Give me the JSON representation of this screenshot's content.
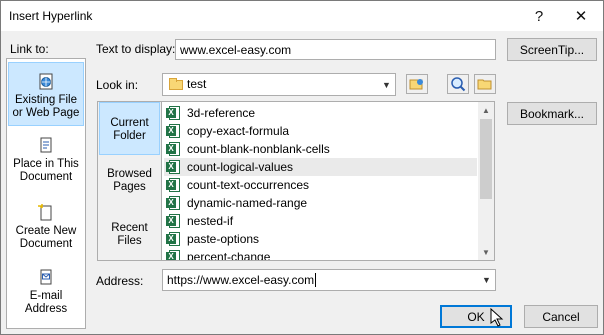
{
  "window": {
    "title": "Insert Hyperlink",
    "help_glyph": "?",
    "close_glyph": "✕"
  },
  "link_to": {
    "heading": "Link to:",
    "items": [
      {
        "label": "Existing File or Web Page",
        "icon": "globe-page-icon",
        "active": true
      },
      {
        "label": "Place in This Document",
        "icon": "document-icon",
        "active": false
      },
      {
        "label": "Create New Document",
        "icon": "new-document-icon",
        "active": false
      },
      {
        "label": "E-mail Address",
        "icon": "email-icon",
        "active": false
      }
    ]
  },
  "text_to_display": {
    "label": "Text to display:",
    "value": "www.excel-easy.com"
  },
  "screentip_button": "ScreenTip...",
  "look_in": {
    "label": "Look in:",
    "value": "test"
  },
  "bookmark_button": "Bookmark...",
  "tabs": [
    {
      "label": "Current Folder",
      "active": true
    },
    {
      "label": "Browsed Pages",
      "active": false
    },
    {
      "label": "Recent Files",
      "active": false
    }
  ],
  "files": [
    "3d-reference",
    "copy-exact-formula",
    "count-blank-nonblank-cells",
    "count-logical-values",
    "count-text-occurrences",
    "dynamic-named-range",
    "nested-if",
    "paste-options",
    "percent-change"
  ],
  "selected_file": "count-logical-values",
  "address": {
    "label": "Address:",
    "value": "https://www.excel-easy.com"
  },
  "ok_button": "OK",
  "cancel_button": "Cancel",
  "colors": {
    "selection": "#cce8ff",
    "excel_green": "#217346",
    "accent": "#0078d7"
  }
}
